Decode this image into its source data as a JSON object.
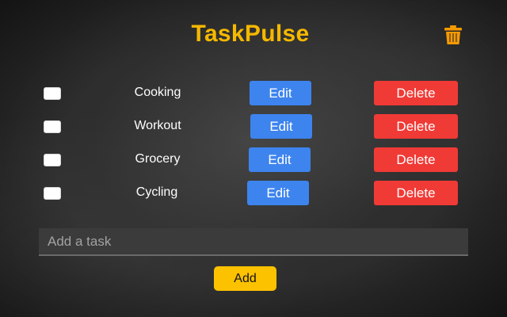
{
  "app": {
    "title": "TaskPulse"
  },
  "header": {
    "trash_icon": "trash-icon"
  },
  "tasks": [
    {
      "label": "Cooking",
      "checked": false,
      "edit_label": "Edit",
      "delete_label": "Delete"
    },
    {
      "label": "Workout",
      "checked": false,
      "edit_label": "Edit",
      "delete_label": "Delete"
    },
    {
      "label": "Grocery",
      "checked": false,
      "edit_label": "Edit",
      "delete_label": "Delete"
    },
    {
      "label": "Cycling",
      "checked": false,
      "edit_label": "Edit",
      "delete_label": "Delete"
    }
  ],
  "input": {
    "placeholder": "Add a task",
    "value": ""
  },
  "add_button": {
    "label": "Add"
  },
  "colors": {
    "title": "#f5b800",
    "edit": "#3d84ee",
    "delete": "#f03a36",
    "add": "#fcc200",
    "trash": "#f59a00"
  }
}
